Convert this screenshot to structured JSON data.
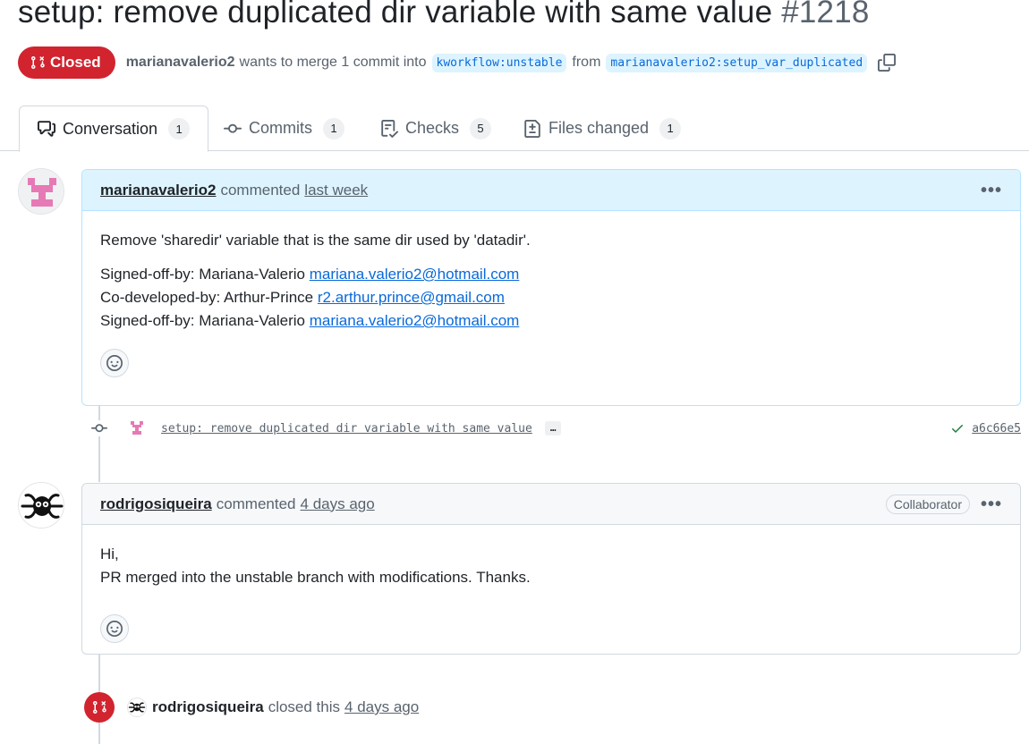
{
  "pr": {
    "title": "setup: remove duplicated dir variable with same value",
    "number": "#1218",
    "state": "Closed",
    "author": "marianavalerio2",
    "merge_text": "wants to merge 1 commit into",
    "base_branch": "kworkflow:unstable",
    "from_text": "from",
    "head_branch": "marianavalerio2:setup_var_duplicated"
  },
  "tabs": [
    {
      "label": "Conversation",
      "count": "1",
      "icon": "comment-discussion-icon"
    },
    {
      "label": "Commits",
      "count": "1",
      "icon": "git-commit-icon"
    },
    {
      "label": "Checks",
      "count": "5",
      "icon": "checklist-icon"
    },
    {
      "label": "Files changed",
      "count": "1",
      "icon": "file-diff-icon"
    }
  ],
  "comments": [
    {
      "author": "marianavalerio2",
      "action": "commented",
      "time": "last week",
      "body": {
        "line1": "Remove 'sharedir' variable that is the same dir used by 'datadir'.",
        "signoff1_prefix": "Signed-off-by: Mariana-Valerio",
        "signoff1_email": "mariana.valerio2@hotmail.com",
        "codev_prefix": "Co-developed-by: Arthur-Prince",
        "codev_email": "r2.arthur.prince@gmail.com",
        "signoff2_prefix": "Signed-off-by: Mariana-Valerio",
        "signoff2_email": "mariana.valerio2@hotmail.com"
      }
    },
    {
      "author": "rodrigosiqueira",
      "action": "commented",
      "time": "4 days ago",
      "role": "Collaborator",
      "body": {
        "line1": "Hi,",
        "line2": "PR merged into the unstable branch with modifications. Thanks."
      }
    }
  ],
  "commit": {
    "message": "setup: remove duplicated dir variable with same value",
    "ellipsis": "…",
    "sha": "a6c66e5"
  },
  "closed_event": {
    "actor": "rodrigosiqueira",
    "action": "closed this",
    "time": "4 days ago"
  },
  "menu": {
    "kebab": "•••"
  },
  "colors": {
    "closed_red": "#d1242f",
    "link_blue": "#0969da",
    "branch_bg": "#ddf4ff",
    "success_green": "#1a7f37",
    "avatar_pink": "#e67ab5"
  }
}
